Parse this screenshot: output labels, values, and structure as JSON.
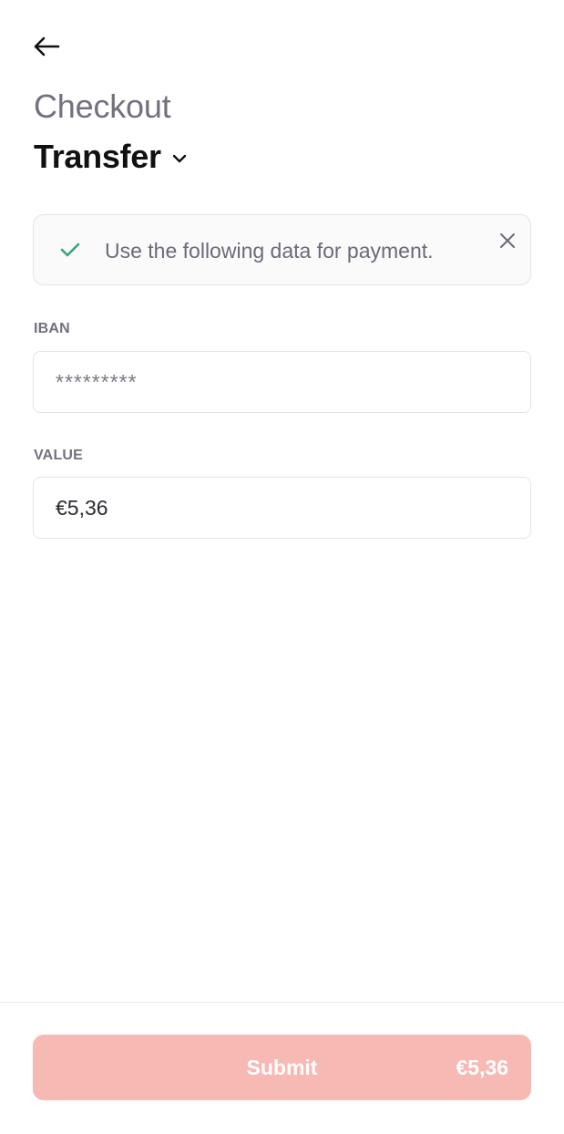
{
  "header": {
    "back_icon": "arrow-left-icon",
    "subtitle": "Checkout",
    "method_label": "Transfer",
    "method_icon": "chevron-down-icon"
  },
  "notice": {
    "icon": "check-icon",
    "text": "Use the following data for payment.",
    "close_icon": "close-icon",
    "accent_color": "#3aa37a"
  },
  "fields": {
    "iban": {
      "label": "IBAN",
      "value": "*********"
    },
    "value": {
      "label": "VALUE",
      "value": "€5,36"
    }
  },
  "footer": {
    "submit_label": "Submit",
    "submit_amount": "€5,36",
    "button_color": "#f7b9b3"
  }
}
